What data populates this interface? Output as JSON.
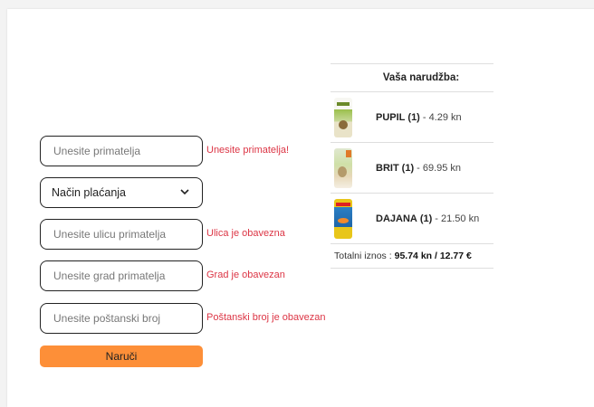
{
  "form": {
    "recipient": {
      "placeholder": "Unesite primatelja",
      "error": "Unesite primatelja!"
    },
    "payment": {
      "selected": "Način plaćanja"
    },
    "street": {
      "placeholder": "Unesite ulicu primatelja",
      "error": "Ulica je obavezna"
    },
    "city": {
      "placeholder": "Unesite grad primatelja",
      "error": "Grad je obavezan"
    },
    "postal": {
      "placeholder": "Unesite poštanski broj",
      "error": "Poštanski broj je obavezan"
    },
    "submit_label": "Naruči"
  },
  "order": {
    "title": "Vaša narudžba:",
    "items": [
      {
        "name": "PUPIL",
        "qty": "(1)",
        "price": "- 4.29 kn"
      },
      {
        "name": "BRIT",
        "qty": "(1)",
        "price": "- 69.95 kn"
      },
      {
        "name": "DAJANA",
        "qty": "(1)",
        "price": "- 21.50 kn"
      }
    ],
    "total_label": "Totalni iznos :",
    "total_value": "95.74 kn / 12.77 €"
  },
  "colors": {
    "error": "#dc3545",
    "button": "#fd8f38"
  }
}
